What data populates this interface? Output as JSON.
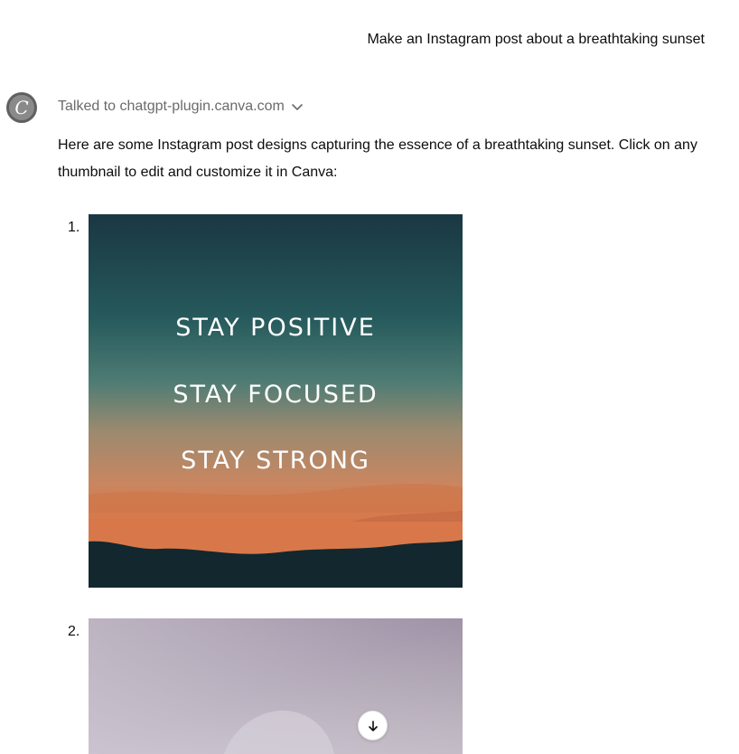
{
  "user_message": "Make an Instagram post about a breathtaking sunset",
  "assistant": {
    "avatar_icon": "canva-logo-icon",
    "plugin_status": "Talked to chatgpt-plugin.canva.com",
    "plugin_toggle_icon": "chevron-down-icon",
    "intro_text": "Here are some Instagram post designs capturing the essence of a breathtaking sunset. Click on any thumbnail to edit and customize it in Canva:",
    "designs": [
      {
        "number": "1.",
        "lines": [
          "STAY POSITIVE",
          "STAY FOCUSED",
          "STAY STRONG"
        ],
        "colors": {
          "sky_top": "#1b3a44",
          "sky_mid": "#2f6b6a",
          "glow": "#c9865a",
          "orange": "#d8784a",
          "hills": "#13272f"
        }
      },
      {
        "number": "2.",
        "colors": {
          "sky": "#a9a0b4",
          "haze": "#c9c3cd"
        }
      }
    ]
  },
  "scroll_button_icon": "arrow-down-icon"
}
